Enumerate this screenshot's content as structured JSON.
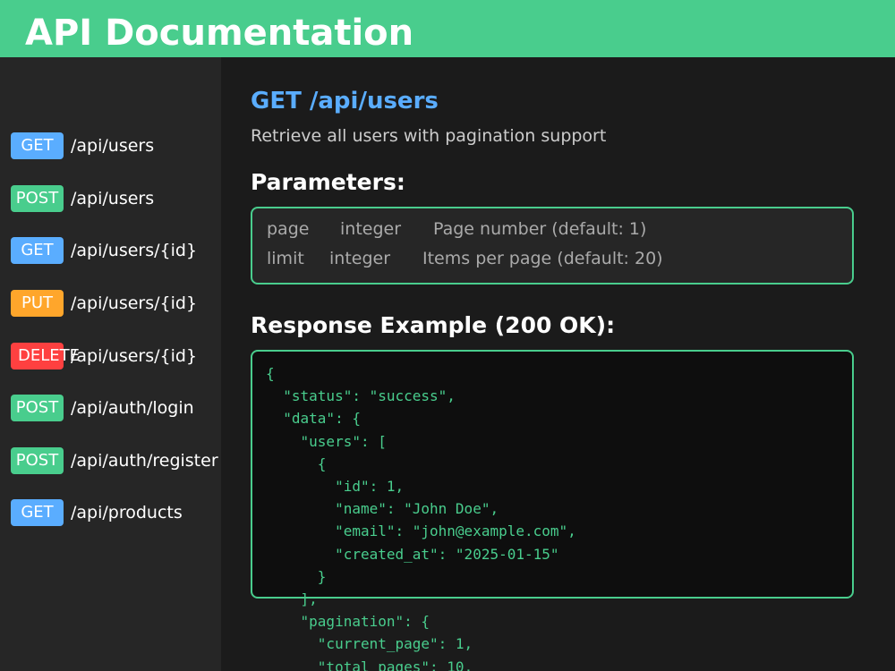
{
  "header": {
    "title": "API Documentation"
  },
  "colors": {
    "header_bg": "#49cd8d",
    "GET": "#5aadff",
    "POST": "#49cd8d",
    "PUT": "#ffa62b",
    "DELETE": "#ff4040",
    "title_blue": "#5aadff",
    "code_green": "#49cd8d"
  },
  "sidebar": {
    "endpoints": [
      {
        "method": "GET",
        "path": "/api/users"
      },
      {
        "method": "POST",
        "path": "/api/users"
      },
      {
        "method": "GET",
        "path": "/api/users/{id}"
      },
      {
        "method": "PUT",
        "path": "/api/users/{id}"
      },
      {
        "method": "DELETE",
        "path": "/api/users/{id}"
      },
      {
        "method": "POST",
        "path": "/api/auth/login"
      },
      {
        "method": "POST",
        "path": "/api/auth/register"
      },
      {
        "method": "GET",
        "path": "/api/products"
      }
    ]
  },
  "main": {
    "endpoint_title": "GET /api/users",
    "description": "Retrieve all users with pagination support",
    "parameters_heading": "Parameters:",
    "parameters": [
      {
        "name": "page",
        "type": "integer",
        "description": "Page number (default: 1)"
      },
      {
        "name": "limit",
        "type": "integer",
        "description": "Items per page (default: 20)"
      }
    ],
    "response_heading": "Response Example (200 OK):",
    "response_code": "{\n  \"status\": \"success\",\n  \"data\": {\n    \"users\": [\n      {\n        \"id\": 1,\n        \"name\": \"John Doe\",\n        \"email\": \"john@example.com\",\n        \"created_at\": \"2025-01-15\"\n      }\n    ],\n    \"pagination\": {\n      \"current_page\": 1,\n      \"total_pages\": 10,"
  }
}
